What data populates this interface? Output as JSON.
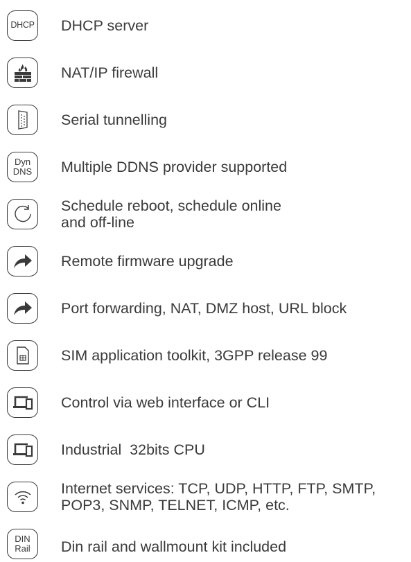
{
  "features": [
    {
      "icon": "dhcp-icon",
      "icon_text": "DHCP",
      "label": "DHCP server"
    },
    {
      "icon": "firewall-icon",
      "label": "NAT/IP firewall"
    },
    {
      "icon": "serial-port-icon",
      "label": "Serial tunnelling"
    },
    {
      "icon": "dyndns-icon",
      "icon_text_1": "Dyn",
      "icon_text_2": "DNS",
      "label": "Multiple DDNS provider supported"
    },
    {
      "icon": "reboot-icon",
      "label_1": "Schedule reboot, schedule online",
      "label_2": "and off-line"
    },
    {
      "icon": "arrow-share-icon",
      "label": "Remote firmware upgrade"
    },
    {
      "icon": "arrow-share-icon",
      "label": "Port forwarding, NAT, DMZ host, URL block"
    },
    {
      "icon": "sim-card-icon",
      "label": "SIM application toolkit, 3GPP release 99"
    },
    {
      "icon": "devices-icon",
      "label": "Control via web interface or CLI"
    },
    {
      "icon": "devices-icon",
      "label": "Industrial  32bits CPU"
    },
    {
      "icon": "wifi-icon",
      "label_1": "Internet services: TCP, UDP, HTTP, FTP, SMTP,",
      "label_2": "POP3, SNMP, TELNET, ICMP, etc."
    },
    {
      "icon": "din-rail-icon",
      "icon_text_1": "DIN",
      "icon_text_2": "Rail",
      "label": "Din rail and wallmount kit included"
    }
  ],
  "colors": {
    "text": "#3a3a3a",
    "icon_stroke": "#3a3a3a",
    "background": "#ffffff"
  }
}
